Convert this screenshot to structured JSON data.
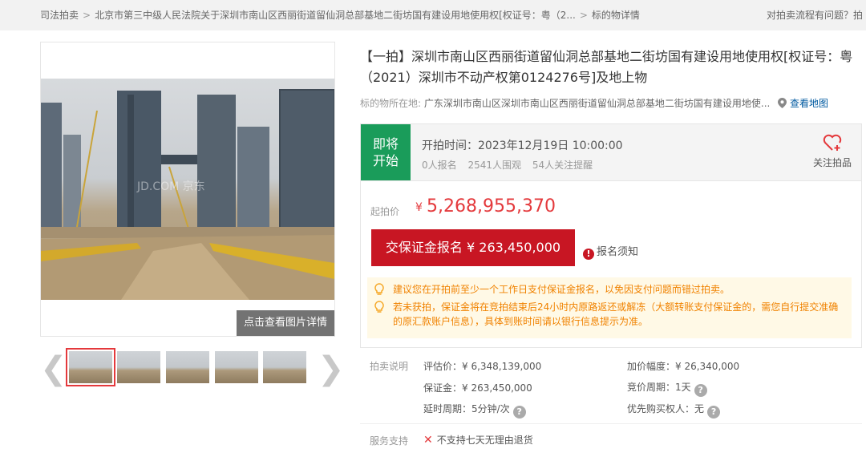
{
  "breadcrumb": {
    "items": [
      "司法拍卖",
      "北京市第三中级人民法院关于深圳市南山区西丽街道留仙洞总部基地二街坊国有建设用地使用权[权证号：粤（2...",
      "标的物详情"
    ],
    "help_text": "对拍卖流程有问题？拍"
  },
  "gallery": {
    "detail_button": "点击查看图片详情",
    "watermark": "JD.COM 京东",
    "thumbnail_count": 5,
    "selected_index": 0
  },
  "lot": {
    "title": "【一拍】深圳市南山区西丽街道留仙洞总部基地二街坊国有建设用地使用权[权证号：粤（2021）深圳市不动产权第0124276号]及地上物",
    "location_label": "标的物所在地:",
    "location": "广东深圳市南山区深圳市南山区西丽街道留仙洞总部基地二街坊国有建设用地使...",
    "map_link": "查看地图"
  },
  "status": {
    "tag_line1": "即将",
    "tag_line2": "开始",
    "start_time": "开拍时间：2023年12月19日 10:00:00",
    "signups": "0人报名",
    "watchers": "2541人围观",
    "reminders": "54人关注提醒",
    "follow_label": "关注拍品"
  },
  "price": {
    "label": "起拍价",
    "currency": "¥",
    "amount": "5,268,955,370",
    "deposit_button": "交保证金报名 ¥ 263,450,000",
    "notice_link": "报名须知"
  },
  "tips": [
    "建议您在开拍前至少一个工作日支付保证金报名，以免因支付问题而错过拍卖。",
    "若未获拍，保证金将在竞拍结束后24小时内原路返还或解冻（大额转账支付保证金的，需您自行提交准确的原汇款账户信息），具体到账时间请以银行信息提示为准。"
  ],
  "specs": {
    "heading": "拍卖说明",
    "appraisal": "评估价：¥ 6,348,139,000",
    "increment": "加价幅度：¥ 26,340,000",
    "deposit": "保证金：¥ 263,450,000",
    "bid_cycle": "竞价周期：1天",
    "extension": "延时周期：5分钟/次",
    "priority_buyer": "优先购买权人：无"
  },
  "service": {
    "heading": "服务支持",
    "item": "不支持七天无理由退货"
  },
  "colors": {
    "accent_red": "#c81623",
    "price_red": "#e4393c",
    "status_green": "#1a9c5a",
    "tip_orange": "#f08200",
    "link_blue": "#005aa0"
  }
}
